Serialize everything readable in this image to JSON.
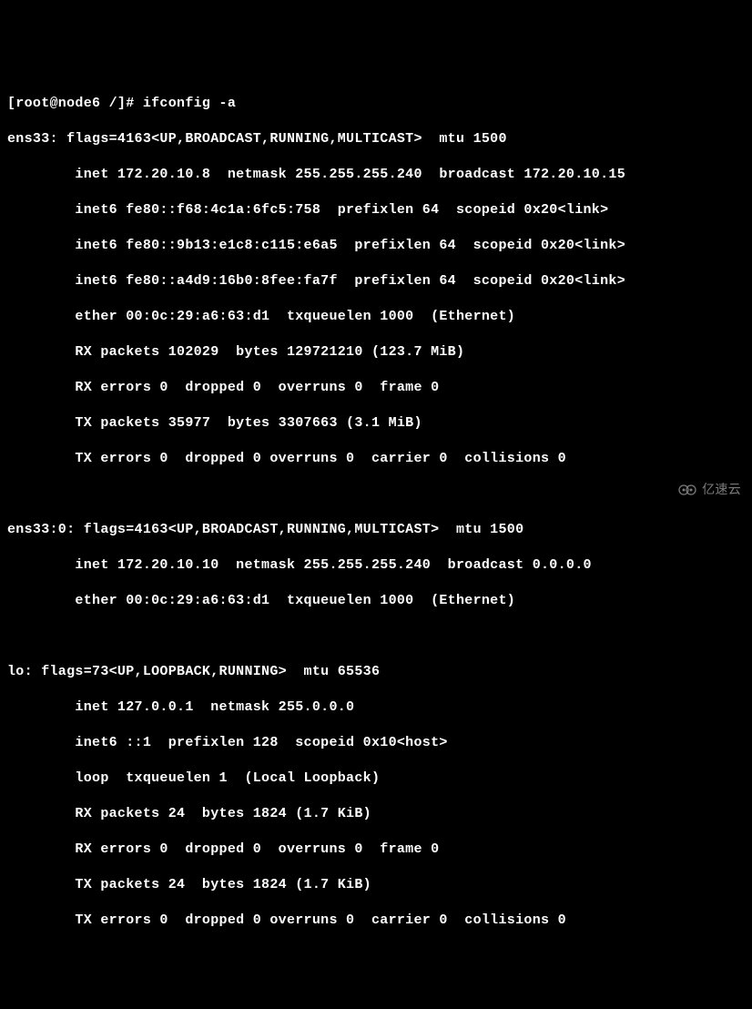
{
  "prompt": "[root@node6 /]# ifconfig -a",
  "ens33": {
    "header": "ens33: flags=4163<UP,BROADCAST,RUNNING,MULTICAST>  mtu 1500",
    "inet": "        inet 172.20.10.8  netmask 255.255.255.240  broadcast 172.20.10.15",
    "inet6a": "        inet6 fe80::f68:4c1a:6fc5:758  prefixlen 64  scopeid 0x20<link>",
    "inet6b": "        inet6 fe80::9b13:e1c8:c115:e6a5  prefixlen 64  scopeid 0x20<link>",
    "inet6c": "        inet6 fe80::a4d9:16b0:8fee:fa7f  prefixlen 64  scopeid 0x20<link>",
    "ether": "        ether 00:0c:29:a6:63:d1  txqueuelen 1000  (Ethernet)",
    "rxp": "        RX packets 102029  bytes 129721210 (123.7 MiB)",
    "rxe": "        RX errors 0  dropped 0  overruns 0  frame 0",
    "txp": "        TX packets 35977  bytes 3307663 (3.1 MiB)",
    "txe": "        TX errors 0  dropped 0 overruns 0  carrier 0  collisions 0"
  },
  "ens33_0": {
    "header": "ens33:0: flags=4163<UP,BROADCAST,RUNNING,MULTICAST>  mtu 1500",
    "inet": "        inet 172.20.10.10  netmask 255.255.255.240  broadcast 0.0.0.0",
    "ether": "        ether 00:0c:29:a6:63:d1  txqueuelen 1000  (Ethernet)"
  },
  "lo": {
    "header": "lo: flags=73<UP,LOOPBACK,RUNNING>  mtu 65536",
    "inet": "        inet 127.0.0.1  netmask 255.0.0.0",
    "inet6": "        inet6 ::1  prefixlen 128  scopeid 0x10<host>",
    "loop": "        loop  txqueuelen 1  (Local Loopback)",
    "rxp": "        RX packets 24  bytes 1824 (1.7 KiB)",
    "rxe": "        RX errors 0  dropped 0  overruns 0  frame 0",
    "txp": "        TX packets 24  bytes 1824 (1.7 KiB)",
    "txe": "        TX errors 0  dropped 0 overruns 0  carrier 0  collisions 0"
  },
  "watermark": "亿速云"
}
